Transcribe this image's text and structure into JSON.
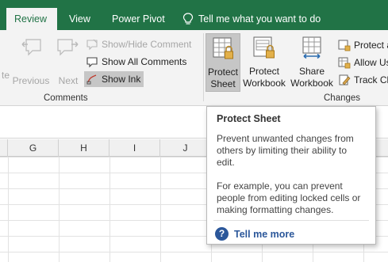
{
  "tabs": [
    {
      "label": "Review",
      "active": true
    },
    {
      "label": "View",
      "active": false
    },
    {
      "label": "Power Pivot",
      "active": false
    }
  ],
  "tell_me": {
    "label": "Tell me what you want to do",
    "icon": "lightbulb-icon"
  },
  "ribbon": {
    "comments_group": {
      "label": "Comments",
      "delete_label": "te",
      "previous_label": "Previous",
      "next_label": "Next",
      "show_hide_label": "Show/Hide Comment",
      "show_all_label": "Show All Comments",
      "show_ink_label": "Show Ink"
    },
    "changes_group": {
      "label": "Changes",
      "protect_sheet": {
        "line1": "Protect",
        "line2": "Sheet"
      },
      "protect_workbook": {
        "line1": "Protect",
        "line2": "Workbook"
      },
      "share_workbook": {
        "line1": "Share",
        "line2": "Workbook"
      },
      "protect_and_share_label": "Protect a",
      "allow_users_label": "Allow Us",
      "track_changes_label": "Track Ch"
    }
  },
  "columns": [
    "G",
    "H",
    "I",
    "J"
  ],
  "tooltip": {
    "title": "Protect Sheet",
    "paragraph1": "Prevent unwanted changes from others by limiting their ability to edit.",
    "paragraph2": "For example, you can prevent people from editing locked cells or making formatting changes.",
    "link_label": "Tell me more"
  },
  "colors": {
    "accent": "#217346",
    "link": "#2b579a"
  }
}
